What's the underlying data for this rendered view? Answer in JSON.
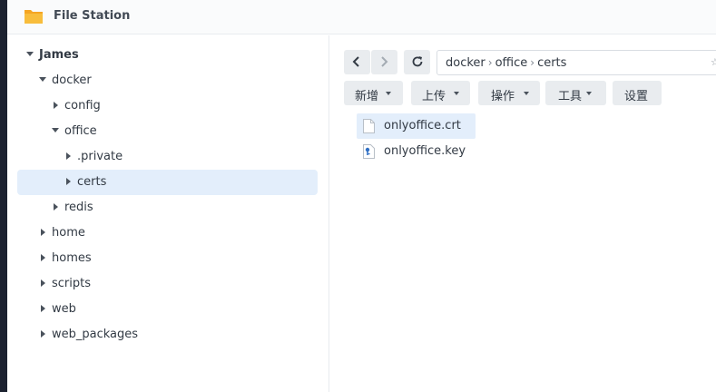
{
  "app": {
    "title": "File Station",
    "accent": "#f5a623"
  },
  "tree": [
    {
      "label": "James",
      "expanded": true,
      "selected": false
    },
    {
      "label": "docker",
      "expanded": true,
      "selected": false
    },
    {
      "label": "config",
      "expanded": false,
      "selected": false
    },
    {
      "label": "office",
      "expanded": true,
      "selected": false
    },
    {
      "label": ".private",
      "expanded": false,
      "selected": false
    },
    {
      "label": "certs",
      "expanded": false,
      "selected": true
    },
    {
      "label": "redis",
      "expanded": false,
      "selected": false
    },
    {
      "label": "home",
      "expanded": false,
      "selected": false
    },
    {
      "label": "homes",
      "expanded": false,
      "selected": false
    },
    {
      "label": "scripts",
      "expanded": false,
      "selected": false
    },
    {
      "label": "web",
      "expanded": false,
      "selected": false
    },
    {
      "label": "web_packages",
      "expanded": false,
      "selected": false
    }
  ],
  "path": {
    "segments": [
      "docker",
      "office",
      "certs"
    ]
  },
  "toolbar": {
    "create": "新增",
    "upload": "上传",
    "action": "操作",
    "tools": "工具",
    "settings": "设置"
  },
  "files": [
    {
      "name": "onlyoffice.crt",
      "icon": "document-icon",
      "selected": true
    },
    {
      "name": "onlyoffice.key",
      "icon": "key-file-icon",
      "selected": false
    }
  ],
  "colors": {
    "selection": "#e3eefb",
    "button": "#e9ecef"
  }
}
